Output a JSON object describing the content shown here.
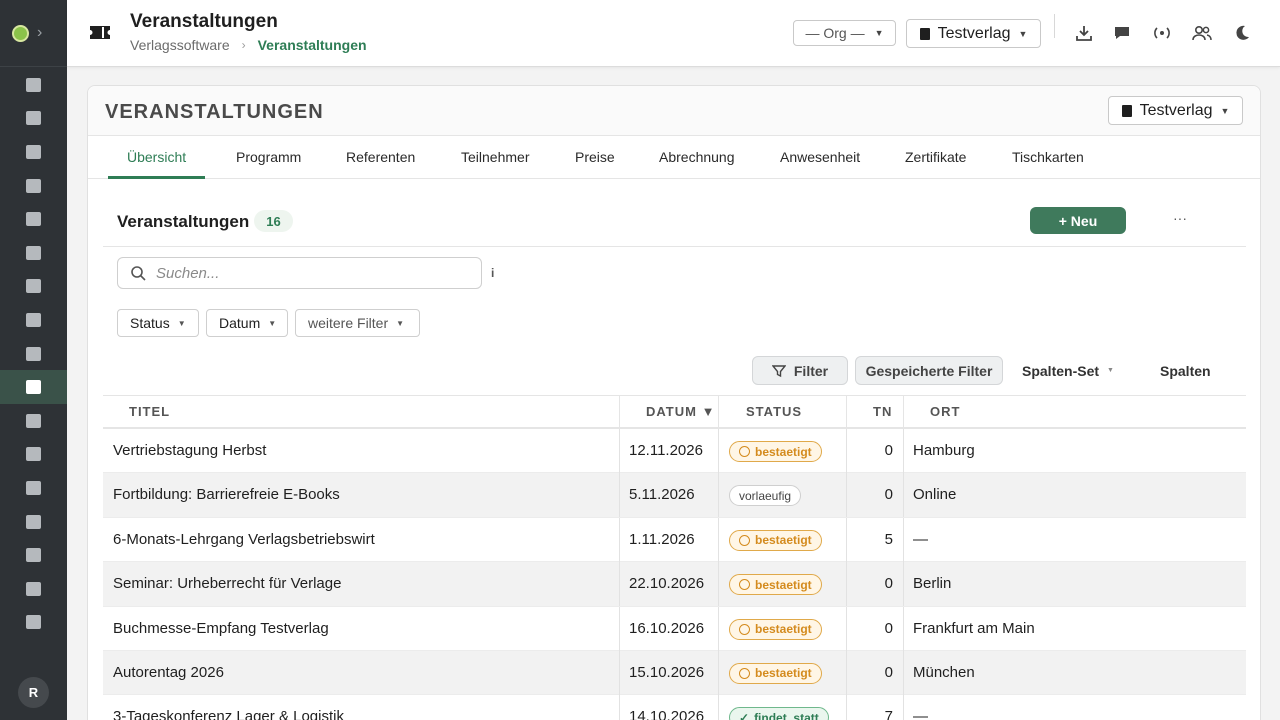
{
  "header": {
    "title": "Veranstaltungen",
    "breadcrumb": [
      "Verlagssoftware",
      "Veranstaltungen"
    ],
    "org_select": "— Org —",
    "verlag_select": "Testverlag"
  },
  "card": {
    "title": "VERANSTALTUNGEN",
    "verlag_select": "Testverlag",
    "tabs": [
      "Übersicht",
      "Programm",
      "Referenten",
      "Teilnehmer",
      "Preise",
      "Abrechnung",
      "Anwesenheit",
      "Zertifikate",
      "Tischkarten"
    ]
  },
  "list": {
    "title": "Veranstaltungen",
    "count": "16",
    "new_button": "+ Neu",
    "more_button": "···",
    "search_placeholder": "Suchen...",
    "info": "i",
    "filters": [
      "Status",
      "Datum",
      "weitere Filter"
    ],
    "tools": {
      "filter": "Filter",
      "saved_filters": "Gespeicherte Filter",
      "column_set": "Spalten-Set",
      "columns": "Spalten"
    }
  },
  "table": {
    "columns": [
      "TITEL",
      "DATUM ▼",
      "STATUS",
      "TN",
      "ORT"
    ],
    "rows": [
      {
        "titel": "Vertriebstagung Herbst",
        "datum": "12.11.2026",
        "status": "bestaetigt",
        "tn": "0",
        "ort": "Hamburg"
      },
      {
        "titel": "Fortbildung: Barrierefreie E-Books",
        "datum": "5.11.2026",
        "status": "vorlaeufig",
        "tn": "0",
        "ort": "Online"
      },
      {
        "titel": "6-Monats-Lehrgang Verlagsbetriebswirt",
        "datum": "1.11.2026",
        "status": "bestaetigt",
        "tn": "5",
        "ort": "—"
      },
      {
        "titel": "Seminar: Urheberrecht für Verlage",
        "datum": "22.10.2026",
        "status": "bestaetigt",
        "tn": "0",
        "ort": "Berlin"
      },
      {
        "titel": "Buchmesse-Empfang Testverlag",
        "datum": "16.10.2026",
        "status": "bestaetigt",
        "tn": "0",
        "ort": "Frankfurt am Main"
      },
      {
        "titel": "Autorentag 2026",
        "datum": "15.10.2026",
        "status": "bestaetigt",
        "tn": "0",
        "ort": "München"
      },
      {
        "titel": "3-Tageskonferenz Lager & Logistik",
        "datum": "14.10.2026",
        "status": "findet_statt",
        "tn": "7",
        "ort": "—"
      }
    ],
    "status_labels": {
      "bestaetigt": "bestaetigt",
      "vorlaeufig": "vorlaeufig",
      "findet_statt": "findet_statt"
    }
  },
  "sidebar": {
    "avatar": "R",
    "items": [
      "image-icon",
      "briefcase-icon",
      "id-card-icon",
      "document-stack-icon",
      "feather-icon",
      "wallet-icon",
      "sync-icon",
      "case-icon",
      "megaphone-icon",
      "ticket-icon",
      "music-icon",
      "file-icon",
      "truck-icon",
      "transfer-icon",
      "chart-icon",
      "report-icon",
      "shield-icon"
    ],
    "active_index": 9
  },
  "colors": {
    "accent": "#2e7d55",
    "sidebar": "#2e3236",
    "status_confirmed": "#d48b1e",
    "status_running": "#2e7d55"
  }
}
